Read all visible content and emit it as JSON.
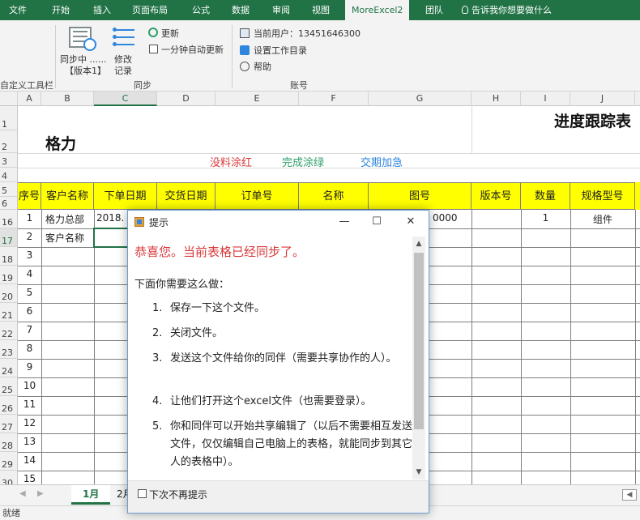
{
  "ribbon_tabs": [
    "文件",
    "开始",
    "插入",
    "页面布局",
    "公式",
    "数据",
    "审阅",
    "视图",
    "MoreExcel2",
    "团队"
  ],
  "tell_me": "告诉我你想要做什么",
  "ribbon": {
    "sync_label_1": "同步中 ......",
    "sync_label_2": "【版本1】",
    "modify_label_1": "修改",
    "modify_label_2": "记录",
    "update_label": "更新",
    "auto_update_label": "一分钟自动更新",
    "sync_group": "同步",
    "current_user": "当前用户：13451646300",
    "set_workdir": "设置工作目录",
    "help": "帮助",
    "account_group": "账号",
    "qat_group": "自定义工具栏"
  },
  "columns": [
    "A",
    "B",
    "C",
    "D",
    "E",
    "F",
    "G",
    "H",
    "I",
    "J"
  ],
  "rows": [
    "1",
    "2",
    "3",
    "4",
    "5",
    "6",
    "16",
    "17",
    "18",
    "19",
    "20",
    "21",
    "22",
    "23",
    "24",
    "25",
    "26",
    "27",
    "28",
    "29",
    "30"
  ],
  "sheet": {
    "title": "进度跟踪表",
    "company": "格力",
    "legend_red": "没料涂红",
    "legend_green": "完成涂绿",
    "legend_blue": "交期加急",
    "headers": [
      "序号",
      "客户名称",
      "下单日期",
      "交货日期",
      "订单号",
      "名称",
      "图号",
      "版本号",
      "数量",
      "规格型号"
    ],
    "row16": {
      "seq": "1",
      "customer": "格力总部",
      "order_date": "2018.",
      "drawing": "0000",
      "qty": "1",
      "spec": "组件"
    },
    "row17": {
      "seq": "2",
      "customer": "客户名称"
    },
    "seq_rest": [
      "3",
      "4",
      "5",
      "6",
      "7",
      "8",
      "9",
      "10",
      "11",
      "12",
      "13",
      "14",
      "15"
    ]
  },
  "sheet_tabs": [
    "1月",
    "2月"
  ],
  "status": "就绪",
  "dialog": {
    "title": "提示",
    "headline": "恭喜您。当前表格已经同步了。",
    "intro": "下面你需要这么做：",
    "steps": [
      {
        "num": "1.",
        "text": "保存一下这个文件。"
      },
      {
        "num": "2.",
        "text": "关闭文件。"
      },
      {
        "num": "3.",
        "text": "发送这个文件给你的同伴（需要共享协作的人）。"
      },
      {
        "num": "4.",
        "text": "让他们打开这个excel文件（也需要登录）。"
      },
      {
        "num": "5.",
        "text": "你和同伴可以开始共享编辑了（以后不需要相互发送文件，仅仅编辑自己电脑上的表格，就能同步到其它人的表格中）。"
      }
    ],
    "dont_show": "下次不再提示"
  },
  "colors": {
    "excel_green": "#217346",
    "header_yellow": "#ffff00",
    "red": "#d9383a",
    "green": "#2e9e6b",
    "blue": "#2e86de"
  }
}
